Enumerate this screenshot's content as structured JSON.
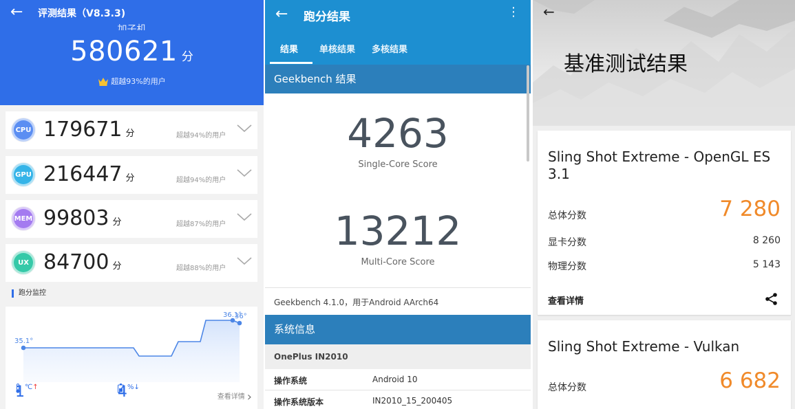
{
  "antutu": {
    "back_icon": "arrow-left-icon",
    "title": "评测结果（V8.3.3)",
    "cut_text": "加子机",
    "total_score": "580621",
    "unit": "分",
    "rank_text": "超越93%的用户",
    "colors": {
      "header": "#2f6ee8",
      "cpu": "#5b8ef2",
      "gpu": "#35b4e8",
      "mem": "#a47bf0",
      "ux": "#35c9a8"
    },
    "cards": [
      {
        "chip": "CPU",
        "score": "179671",
        "unit": "分",
        "pct": "超越94%的用户"
      },
      {
        "chip": "GPU",
        "score": "216447",
        "unit": "分",
        "pct": "超越94%的用户"
      },
      {
        "chip": "MEM",
        "score": "99803",
        "unit": "分",
        "pct": "超越87%的用户"
      },
      {
        "chip": "UX",
        "score": "84700",
        "unit": "分",
        "pct": "超越88%的用户"
      }
    ],
    "monitor_label": "跑分监控",
    "temp_start": "35.1°",
    "temp_end_a": "36.1°",
    "temp_end_b": "36°",
    "temp_rise": "1",
    "temp_unit": "℃",
    "temp_arrow": "↑",
    "battery_drop": "4",
    "battery_unit": "%",
    "battery_arrow": "↓",
    "more_label": "查看详情"
  },
  "geekbench": {
    "title": "跑分结果",
    "tabs": [
      "结果",
      "单核结果",
      "多核结果"
    ],
    "section_title": "Geekbench 结果",
    "single_score": "4263",
    "single_label": "Single-Core Score",
    "multi_score": "13212",
    "multi_label": "Multi-Core Score",
    "version_line": "Geekbench 4.1.0，用于Android AArch64",
    "sysinfo_title": "系统信息",
    "device": "OnePlus IN2010",
    "rows": [
      {
        "k": "操作系统",
        "v": "Android 10"
      },
      {
        "k": "操作系统版本",
        "v": "IN2010_15_200405"
      }
    ]
  },
  "threedmark": {
    "title": "基准测试结果",
    "card1": {
      "name": "Sling Shot Extreme - OpenGL ES 3.1",
      "total_label": "总体分数",
      "total": "7 280",
      "gpu_label": "显卡分数",
      "gpu": "8 260",
      "phys_label": "物理分数",
      "phys": "5 143",
      "detail_label": "查看详情"
    },
    "card2": {
      "name": "Sling Shot Extreme - Vulkan",
      "total_label": "总体分数",
      "total": "6 682"
    },
    "accent": "#f08a2a"
  }
}
